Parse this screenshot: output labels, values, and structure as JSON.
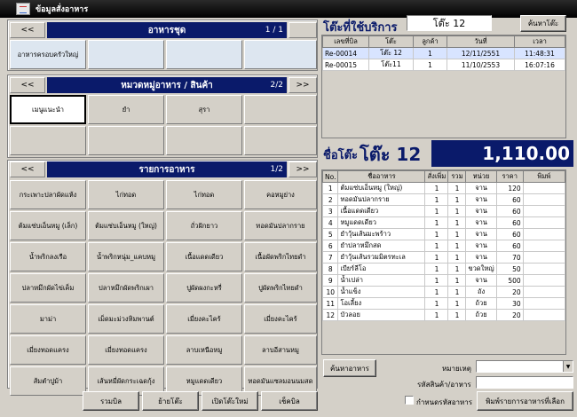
{
  "window": {
    "title": "ข้อมูลสั่งอาหาร"
  },
  "set_menu": {
    "title": "อาหารชุด",
    "page": "1 / 1",
    "prev": "<<",
    "next": ">>",
    "items": [
      "อาหารครอบครัวใหญ่"
    ]
  },
  "category": {
    "title": "หมวดหมู่อาหาร / สินค้า",
    "page": "2/2",
    "prev": "<<",
    "next": ">>",
    "items": [
      "เมนูแนะนำ",
      "ยำ",
      "สุรา"
    ]
  },
  "food_list": {
    "title": "รายการอาหาร",
    "page": "1/2",
    "prev": "<<",
    "next": ">>",
    "items": [
      "กระเพาะปลาผัดแห้ง",
      "ไก่ทอด",
      "ไก่ทอด",
      "คอหมูย่าง",
      "ต้มแซ่บเอ็นหมู (เล็ก)",
      "ต้มแซ่บเอ็นหมู (ใหญ่)",
      "ถั่วฝักยาว",
      "ทอดมันปลากราย",
      "น้ำพริกลงเรือ",
      "น้ำพริกหนุ่ม_แคบหมู",
      "เนื้อแดดเดียว",
      "เนื้อผัดพริกไทยดำ",
      "ปลาหมึกผัดไข่เค็ม",
      "ปลาหมึกผัดพริกเผา",
      "ปูผัดผงกะหรี่",
      "ปูผัดพริกไทยดำ",
      "มาม่า",
      "เม็ดมะม่วงหิมพานต์",
      "เมี่ยงคะไคร้",
      "เมี่ยงคะไคร้",
      "เมี่ยงทอดแครง",
      "เมี่ยงทอดแครง",
      "ลาบเหนือหมู",
      "ลาบอีสานหมู",
      "ส้มตำปูม้า",
      "เส้นหมี่ผัดกระเฉดกุ้ง",
      "หมูแดดเดียว",
      "ทอดมันแซลมอนนมสด"
    ]
  },
  "bottom_buttons": [
    "รวมบิล",
    "ย้ายโต๊ะ",
    "เปิดโต๊ะใหม่",
    "เช็คบิล"
  ],
  "tables_in_use": {
    "title": "โต๊ะที่ใช้บริการ",
    "search_value": "โต๊ะ 12",
    "search_button": "ค้นหาโต๊ะ",
    "columns": [
      "เลขที่บิล",
      "โต๊ะ",
      "ลูกค้า",
      "วันที่",
      "เวลา"
    ],
    "rows": [
      [
        "Re-00014",
        "โต๊ะ 12",
        "1",
        "12/11/2551",
        "11:48:31"
      ],
      [
        "Re-00015",
        "โต๊ะ11",
        "1",
        "11/10/2553",
        "16:07:16"
      ]
    ]
  },
  "current_table": {
    "label": "ชื่อโต๊ะ",
    "name": "โต๊ะ 12",
    "total": "1,110.00"
  },
  "order": {
    "columns": [
      "No.",
      "ชื่ออาหาร",
      "สั่งเพิ่ม",
      "รวม",
      "หน่วย",
      "ราคา",
      "พิมพ์"
    ],
    "rows": [
      [
        "1",
        "ต้มแซ่บเอ็นหมู (ใหญ่)",
        "1",
        "1",
        "จาน",
        "120",
        ""
      ],
      [
        "2",
        "ทอดมันปลากราย",
        "1",
        "1",
        "จาน",
        "60",
        ""
      ],
      [
        "3",
        "เนื้อแดดเดียว",
        "1",
        "1",
        "จาน",
        "60",
        ""
      ],
      [
        "4",
        "หมูแดดเดียว",
        "1",
        "1",
        "จาน",
        "60",
        ""
      ],
      [
        "5",
        "ยำวุ้นเส้นมะพร้าว",
        "1",
        "1",
        "จาน",
        "60",
        ""
      ],
      [
        "6",
        "ยำปลาหมึกสด",
        "1",
        "1",
        "จาน",
        "60",
        ""
      ],
      [
        "7",
        "ยำวุ้นเส้นรวมมิตรทะเล",
        "1",
        "1",
        "จาน",
        "70",
        ""
      ],
      [
        "8",
        "เบียร์ลีโอ",
        "1",
        "1",
        "ขวดใหญ่",
        "50",
        ""
      ],
      [
        "9",
        "น้ำเปล่า",
        "1",
        "1",
        "จาน",
        "500",
        ""
      ],
      [
        "10",
        "น้ำแข็ง",
        "1",
        "1",
        "ถัง",
        "20",
        ""
      ],
      [
        "11",
        "โอเลี้ยง",
        "1",
        "1",
        "ถ้วย",
        "30",
        ""
      ],
      [
        "12",
        "บัวลอย",
        "1",
        "1",
        "ถ้วย",
        "20",
        ""
      ]
    ]
  },
  "search_food_button": "ค้นหาอาหาร",
  "note_label": "หมายเหตุ",
  "code_label": "รหัสสินค้า/อาหาร",
  "select_all_label": "กำหนดรหัสอาหาร",
  "print_button": "พิมพ์รายการอาหารที่เลือก"
}
